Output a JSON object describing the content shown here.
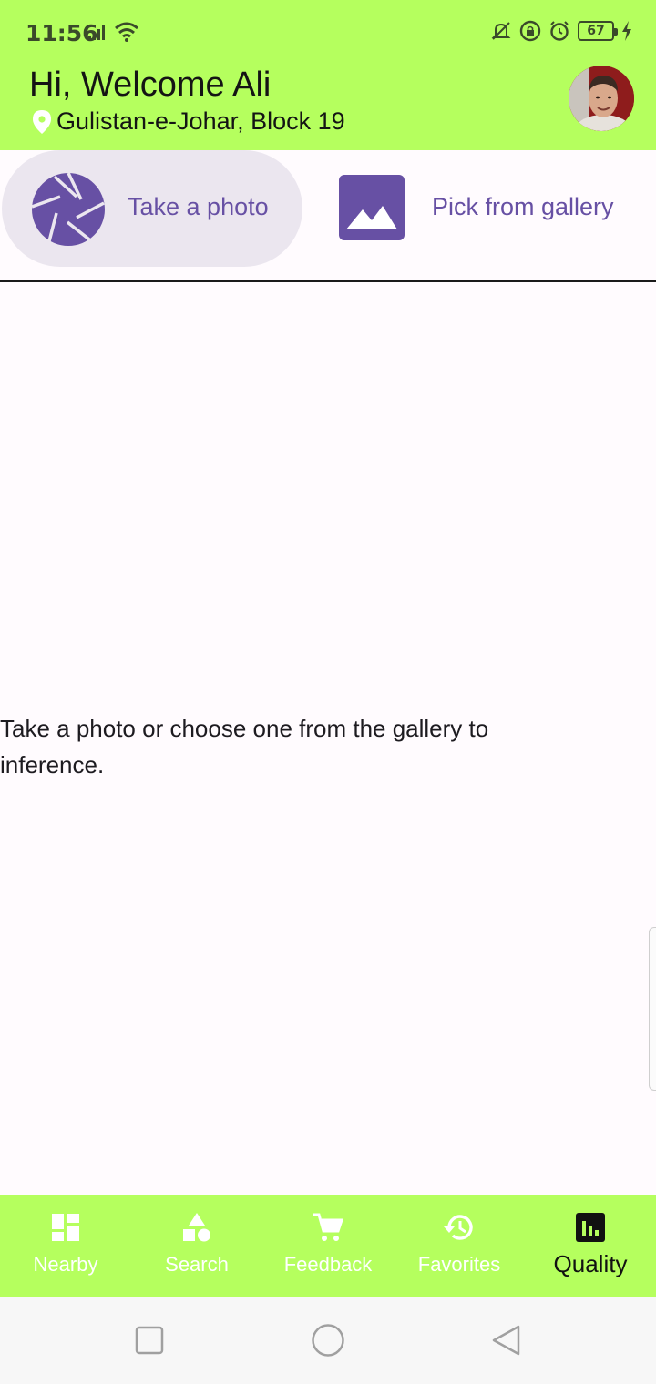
{
  "status_bar": {
    "time": "11:56",
    "battery": "67",
    "left_icons": [
      "signal-icon",
      "wifi-icon"
    ],
    "right_icons": [
      "mute-icon",
      "vpn-lock-icon",
      "alarm-icon",
      "battery-icon",
      "charging-icon"
    ]
  },
  "header": {
    "greeting": "Hi, Welcome Ali",
    "location": "Gulistan-e-Johar, Block 19",
    "background": "#b5ff5e"
  },
  "actions": {
    "take_photo": "Take a photo",
    "pick_gallery": "Pick from gallery",
    "accent": "#6750a4"
  },
  "main": {
    "instruction": "Take a photo or choose one from the gallery to inference."
  },
  "bottom_nav": {
    "items": [
      {
        "label": "Nearby",
        "icon": "dashboard-icon"
      },
      {
        "label": "Search",
        "icon": "category-icon"
      },
      {
        "label": "Feedback",
        "icon": "cart-icon"
      },
      {
        "label": "Favorites",
        "icon": "history-icon"
      },
      {
        "label": "Quality",
        "icon": "bar-chart-icon"
      }
    ],
    "active": "Quality"
  },
  "system_nav": {
    "buttons": [
      "recents-icon",
      "home-icon",
      "back-icon"
    ]
  }
}
